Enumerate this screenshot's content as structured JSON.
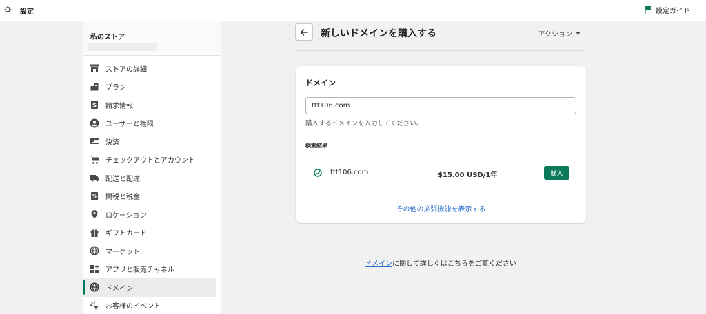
{
  "topbar": {
    "title": "設定",
    "guide_label": "設定ガイド"
  },
  "sidebar": {
    "store_name": "私のストア",
    "items": [
      {
        "label": "ストアの詳細",
        "icon": "store-icon"
      },
      {
        "label": "プラン",
        "icon": "plan-icon"
      },
      {
        "label": "請求情報",
        "icon": "dollar-icon"
      },
      {
        "label": "ユーザーと権限",
        "icon": "user-icon"
      },
      {
        "label": "決済",
        "icon": "credit-card-icon"
      },
      {
        "label": "チェックアウトとアカウント",
        "icon": "cart-icon"
      },
      {
        "label": "配送と配達",
        "icon": "truck-icon"
      },
      {
        "label": "関税と税金",
        "icon": "tax-icon"
      },
      {
        "label": "ロケーション",
        "icon": "location-icon"
      },
      {
        "label": "ギフトカード",
        "icon": "gift-icon"
      },
      {
        "label": "マーケット",
        "icon": "globe-icon"
      },
      {
        "label": "アプリと販売チャネル",
        "icon": "apps-icon"
      },
      {
        "label": "ドメイン",
        "icon": "globe-icon",
        "active": true
      },
      {
        "label": "お客様のイベント",
        "icon": "sparkle-icon"
      }
    ]
  },
  "page": {
    "title": "新しいドメインを購入する",
    "actions_label": "アクション"
  },
  "card": {
    "title": "ドメイン",
    "input_value": "ttt106.com",
    "help_text": "購入するドメインを入力してください。",
    "results_label": "検索結果",
    "result": {
      "domain": "ttt106.com",
      "price": "$15.00 USD/1年",
      "buy_label": "購入"
    },
    "more_link": "その他の拡張機能を表示する"
  },
  "footer": {
    "link_text": "ドメイン",
    "rest_text": "に関して詳しくはこちらをご覧ください"
  },
  "colors": {
    "accent": "#007a5c",
    "button": "#0a7a5a",
    "link": "#2c6ecb",
    "background": "#f1f1f1"
  }
}
